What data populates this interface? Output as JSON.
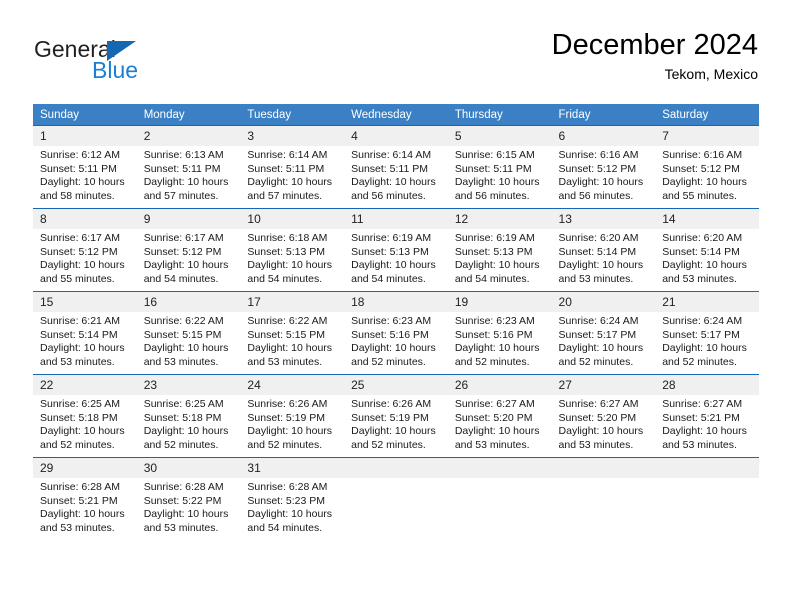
{
  "brand": {
    "name_top": "General",
    "name_bottom": "Blue",
    "triangle_color": "#1567b3",
    "blue_color": "#1b7fd4"
  },
  "header": {
    "title": "December 2024",
    "subtitle": "Tekom, Mexico"
  },
  "colors": {
    "header_blue": "#3b80c4",
    "row_border_blue": "#1567b3",
    "daynum_band": "#f0f0f0"
  },
  "weekday_headers": [
    "Sunday",
    "Monday",
    "Tuesday",
    "Wednesday",
    "Thursday",
    "Friday",
    "Saturday"
  ],
  "weeks": [
    [
      {
        "day": "1",
        "sunrise": "Sunrise: 6:12 AM",
        "sunset": "Sunset: 5:11 PM",
        "daylight1": "Daylight: 10 hours",
        "daylight2": "and 58 minutes."
      },
      {
        "day": "2",
        "sunrise": "Sunrise: 6:13 AM",
        "sunset": "Sunset: 5:11 PM",
        "daylight1": "Daylight: 10 hours",
        "daylight2": "and 57 minutes."
      },
      {
        "day": "3",
        "sunrise": "Sunrise: 6:14 AM",
        "sunset": "Sunset: 5:11 PM",
        "daylight1": "Daylight: 10 hours",
        "daylight2": "and 57 minutes."
      },
      {
        "day": "4",
        "sunrise": "Sunrise: 6:14 AM",
        "sunset": "Sunset: 5:11 PM",
        "daylight1": "Daylight: 10 hours",
        "daylight2": "and 56 minutes."
      },
      {
        "day": "5",
        "sunrise": "Sunrise: 6:15 AM",
        "sunset": "Sunset: 5:11 PM",
        "daylight1": "Daylight: 10 hours",
        "daylight2": "and 56 minutes."
      },
      {
        "day": "6",
        "sunrise": "Sunrise: 6:16 AM",
        "sunset": "Sunset: 5:12 PM",
        "daylight1": "Daylight: 10 hours",
        "daylight2": "and 56 minutes."
      },
      {
        "day": "7",
        "sunrise": "Sunrise: 6:16 AM",
        "sunset": "Sunset: 5:12 PM",
        "daylight1": "Daylight: 10 hours",
        "daylight2": "and 55 minutes."
      }
    ],
    [
      {
        "day": "8",
        "sunrise": "Sunrise: 6:17 AM",
        "sunset": "Sunset: 5:12 PM",
        "daylight1": "Daylight: 10 hours",
        "daylight2": "and 55 minutes."
      },
      {
        "day": "9",
        "sunrise": "Sunrise: 6:17 AM",
        "sunset": "Sunset: 5:12 PM",
        "daylight1": "Daylight: 10 hours",
        "daylight2": "and 54 minutes."
      },
      {
        "day": "10",
        "sunrise": "Sunrise: 6:18 AM",
        "sunset": "Sunset: 5:13 PM",
        "daylight1": "Daylight: 10 hours",
        "daylight2": "and 54 minutes."
      },
      {
        "day": "11",
        "sunrise": "Sunrise: 6:19 AM",
        "sunset": "Sunset: 5:13 PM",
        "daylight1": "Daylight: 10 hours",
        "daylight2": "and 54 minutes."
      },
      {
        "day": "12",
        "sunrise": "Sunrise: 6:19 AM",
        "sunset": "Sunset: 5:13 PM",
        "daylight1": "Daylight: 10 hours",
        "daylight2": "and 54 minutes."
      },
      {
        "day": "13",
        "sunrise": "Sunrise: 6:20 AM",
        "sunset": "Sunset: 5:14 PM",
        "daylight1": "Daylight: 10 hours",
        "daylight2": "and 53 minutes."
      },
      {
        "day": "14",
        "sunrise": "Sunrise: 6:20 AM",
        "sunset": "Sunset: 5:14 PM",
        "daylight1": "Daylight: 10 hours",
        "daylight2": "and 53 minutes."
      }
    ],
    [
      {
        "day": "15",
        "sunrise": "Sunrise: 6:21 AM",
        "sunset": "Sunset: 5:14 PM",
        "daylight1": "Daylight: 10 hours",
        "daylight2": "and 53 minutes."
      },
      {
        "day": "16",
        "sunrise": "Sunrise: 6:22 AM",
        "sunset": "Sunset: 5:15 PM",
        "daylight1": "Daylight: 10 hours",
        "daylight2": "and 53 minutes."
      },
      {
        "day": "17",
        "sunrise": "Sunrise: 6:22 AM",
        "sunset": "Sunset: 5:15 PM",
        "daylight1": "Daylight: 10 hours",
        "daylight2": "and 53 minutes."
      },
      {
        "day": "18",
        "sunrise": "Sunrise: 6:23 AM",
        "sunset": "Sunset: 5:16 PM",
        "daylight1": "Daylight: 10 hours",
        "daylight2": "and 52 minutes."
      },
      {
        "day": "19",
        "sunrise": "Sunrise: 6:23 AM",
        "sunset": "Sunset: 5:16 PM",
        "daylight1": "Daylight: 10 hours",
        "daylight2": "and 52 minutes."
      },
      {
        "day": "20",
        "sunrise": "Sunrise: 6:24 AM",
        "sunset": "Sunset: 5:17 PM",
        "daylight1": "Daylight: 10 hours",
        "daylight2": "and 52 minutes."
      },
      {
        "day": "21",
        "sunrise": "Sunrise: 6:24 AM",
        "sunset": "Sunset: 5:17 PM",
        "daylight1": "Daylight: 10 hours",
        "daylight2": "and 52 minutes."
      }
    ],
    [
      {
        "day": "22",
        "sunrise": "Sunrise: 6:25 AM",
        "sunset": "Sunset: 5:18 PM",
        "daylight1": "Daylight: 10 hours",
        "daylight2": "and 52 minutes."
      },
      {
        "day": "23",
        "sunrise": "Sunrise: 6:25 AM",
        "sunset": "Sunset: 5:18 PM",
        "daylight1": "Daylight: 10 hours",
        "daylight2": "and 52 minutes."
      },
      {
        "day": "24",
        "sunrise": "Sunrise: 6:26 AM",
        "sunset": "Sunset: 5:19 PM",
        "daylight1": "Daylight: 10 hours",
        "daylight2": "and 52 minutes."
      },
      {
        "day": "25",
        "sunrise": "Sunrise: 6:26 AM",
        "sunset": "Sunset: 5:19 PM",
        "daylight1": "Daylight: 10 hours",
        "daylight2": "and 52 minutes."
      },
      {
        "day": "26",
        "sunrise": "Sunrise: 6:27 AM",
        "sunset": "Sunset: 5:20 PM",
        "daylight1": "Daylight: 10 hours",
        "daylight2": "and 53 minutes."
      },
      {
        "day": "27",
        "sunrise": "Sunrise: 6:27 AM",
        "sunset": "Sunset: 5:20 PM",
        "daylight1": "Daylight: 10 hours",
        "daylight2": "and 53 minutes."
      },
      {
        "day": "28",
        "sunrise": "Sunrise: 6:27 AM",
        "sunset": "Sunset: 5:21 PM",
        "daylight1": "Daylight: 10 hours",
        "daylight2": "and 53 minutes."
      }
    ],
    [
      {
        "day": "29",
        "sunrise": "Sunrise: 6:28 AM",
        "sunset": "Sunset: 5:21 PM",
        "daylight1": "Daylight: 10 hours",
        "daylight2": "and 53 minutes."
      },
      {
        "day": "30",
        "sunrise": "Sunrise: 6:28 AM",
        "sunset": "Sunset: 5:22 PM",
        "daylight1": "Daylight: 10 hours",
        "daylight2": "and 53 minutes."
      },
      {
        "day": "31",
        "sunrise": "Sunrise: 6:28 AM",
        "sunset": "Sunset: 5:23 PM",
        "daylight1": "Daylight: 10 hours",
        "daylight2": "and 54 minutes."
      },
      {
        "day": "",
        "sunrise": "",
        "sunset": "",
        "daylight1": "",
        "daylight2": ""
      },
      {
        "day": "",
        "sunrise": "",
        "sunset": "",
        "daylight1": "",
        "daylight2": ""
      },
      {
        "day": "",
        "sunrise": "",
        "sunset": "",
        "daylight1": "",
        "daylight2": ""
      },
      {
        "day": "",
        "sunrise": "",
        "sunset": "",
        "daylight1": "",
        "daylight2": ""
      }
    ]
  ]
}
